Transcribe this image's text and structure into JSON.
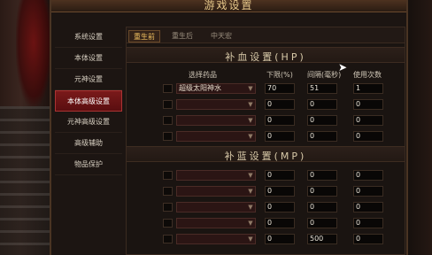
{
  "window": {
    "title": "游戏设置"
  },
  "sidebar": {
    "items": [
      {
        "label": "系统设置"
      },
      {
        "label": "本体设置"
      },
      {
        "label": "元神设置"
      },
      {
        "label": "本体高级设置",
        "active": true
      },
      {
        "label": "元神高级设置"
      },
      {
        "label": "高级辅助"
      },
      {
        "label": "物品保护"
      }
    ]
  },
  "tabs": [
    {
      "label": "重生前",
      "active": true
    },
    {
      "label": "重生后"
    },
    {
      "label": "中天宏"
    }
  ],
  "hp_section": {
    "title": "补血设置(HP)",
    "col_item": "选择药品",
    "col_lower": "下限(%)",
    "col_interval": "间隔(毫秒)",
    "col_count": "使用次数",
    "rows": [
      {
        "item": "超级太阳神水",
        "lower": "70",
        "interval": "51",
        "count": "1"
      },
      {
        "item": "",
        "lower": "0",
        "interval": "0",
        "count": "0"
      },
      {
        "item": "",
        "lower": "0",
        "interval": "0",
        "count": "0"
      },
      {
        "item": "",
        "lower": "0",
        "interval": "0",
        "count": "0"
      }
    ]
  },
  "mp_section": {
    "title": "补蓝设置(MP)",
    "rows": [
      {
        "item": "",
        "lower": "0",
        "interval": "0",
        "count": "0"
      },
      {
        "item": "",
        "lower": "0",
        "interval": "0",
        "count": "0"
      },
      {
        "item": "",
        "lower": "0",
        "interval": "0",
        "count": "0"
      },
      {
        "item": "",
        "lower": "0",
        "interval": "0",
        "count": "0"
      },
      {
        "item": "",
        "lower": "0",
        "interval": "500",
        "count": "0"
      }
    ]
  },
  "icons": {
    "dropdown": "chevron-down-icon",
    "cursor": "mouse-cursor-icon"
  }
}
